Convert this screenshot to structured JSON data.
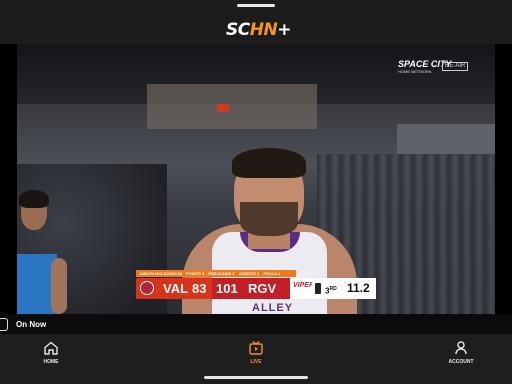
{
  "app": {
    "logo_part1": "SC",
    "logo_part2": "HN",
    "logo_plus": "+"
  },
  "player": {
    "network_name": "SPACE CITY",
    "network_sub": "HOME NETWORK",
    "network_tag": "RE-AIR",
    "jersey_text": "ALLEY"
  },
  "scorebug": {
    "info_name": "JABARI MCLAUGHLIN",
    "info_points": "POINTS 5",
    "info_rebounds": "REBOUNDS 2",
    "info_assists": "ASSISTS 2",
    "info_fouls": "FOULS 4",
    "away_team": "VAL",
    "away_score": "83",
    "home_score": "101",
    "home_team": "RGV",
    "home_logo": "VIPERS",
    "quarter": "3",
    "quarter_suffix": "RD",
    "clock": "11.2"
  },
  "on_now": {
    "label": "On Now"
  },
  "nav": {
    "home": "HOME",
    "live": "LIVE",
    "account": "ACCOUNT",
    "active": "live"
  },
  "colors": {
    "accent": "#f7931e",
    "away_red": "#d7331b",
    "home_red": "#c21f28"
  }
}
